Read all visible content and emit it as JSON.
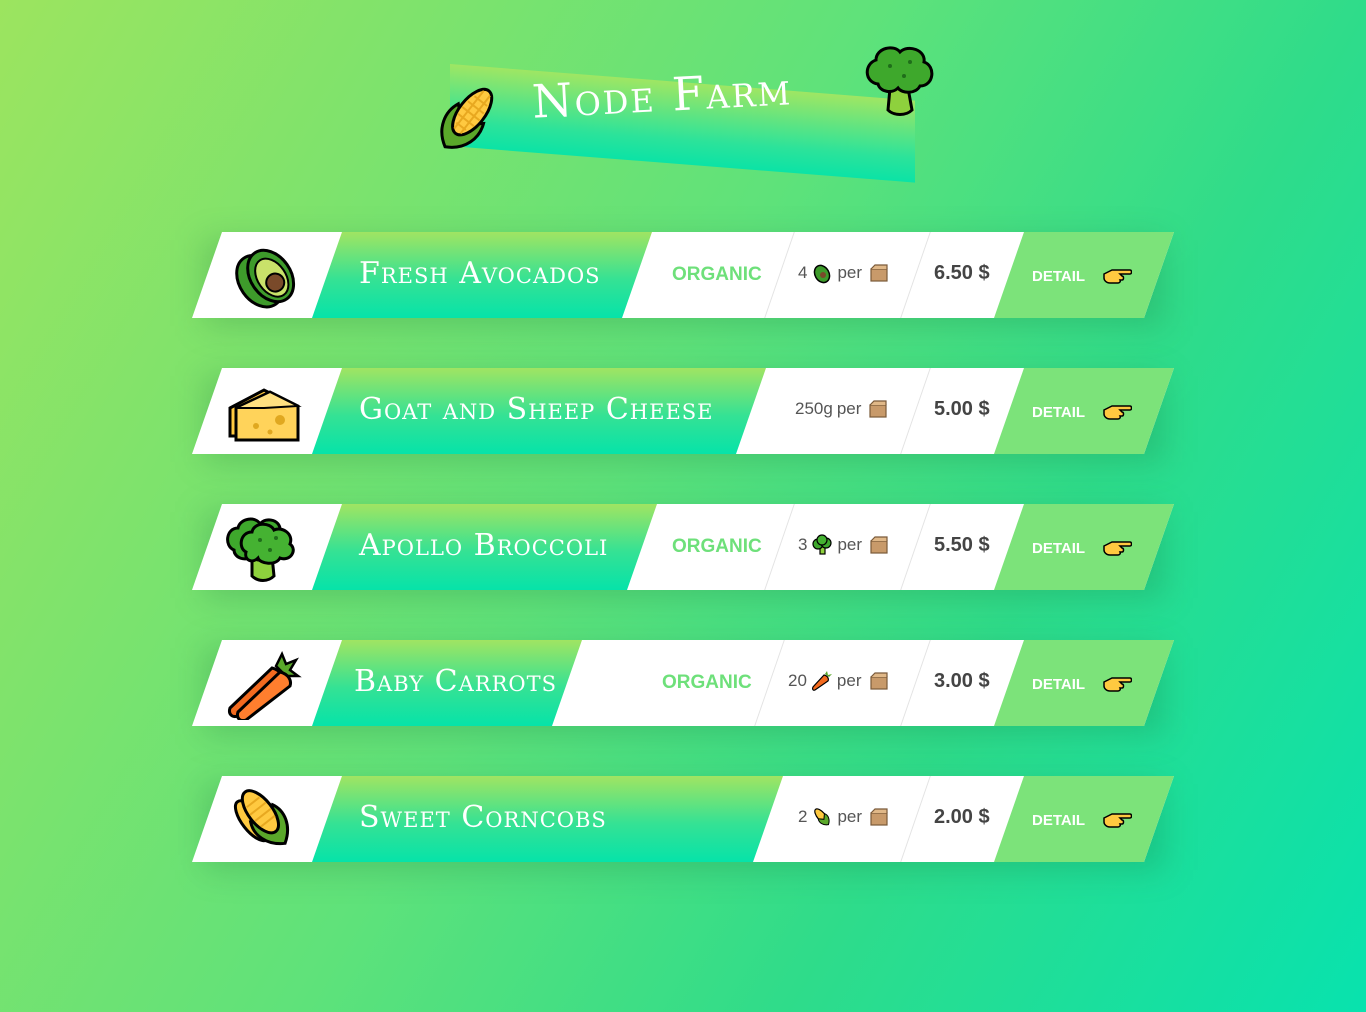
{
  "header": {
    "title": "Node Farm",
    "left_icon": "corn-icon",
    "right_icon": "broccoli-icon"
  },
  "products": [
    {
      "name": "Fresh Avocados",
      "icon": "avocado-icon",
      "organic_label": "ORGANIC",
      "quantity": "4",
      "per": "per",
      "price": "6.50 $",
      "detail_label": "DETAIL"
    },
    {
      "name": "Goat and Sheep Cheese",
      "icon": "cheese-icon",
      "organic_label": "",
      "quantity": "250g",
      "per": "per",
      "price": "5.00 $",
      "detail_label": "DETAIL"
    },
    {
      "name": "Apollo Broccoli",
      "icon": "broccoli-icon",
      "organic_label": "ORGANIC",
      "quantity": "3",
      "per": "per",
      "price": "5.50 $",
      "detail_label": "DETAIL"
    },
    {
      "name": "Baby Carrots",
      "icon": "carrot-icon",
      "organic_label": "ORGANIC",
      "quantity": "20",
      "per": "per",
      "price": "3.00 $",
      "detail_label": "DETAIL"
    },
    {
      "name": "Sweet Corncobs",
      "icon": "corn-icon",
      "organic_label": "",
      "quantity": "2",
      "per": "per",
      "price": "2.00 $",
      "detail_label": "DETAIL"
    }
  ],
  "colors": {
    "organic": "#6ee07a",
    "detail_button": "#7ce37a",
    "price": "#444444"
  }
}
